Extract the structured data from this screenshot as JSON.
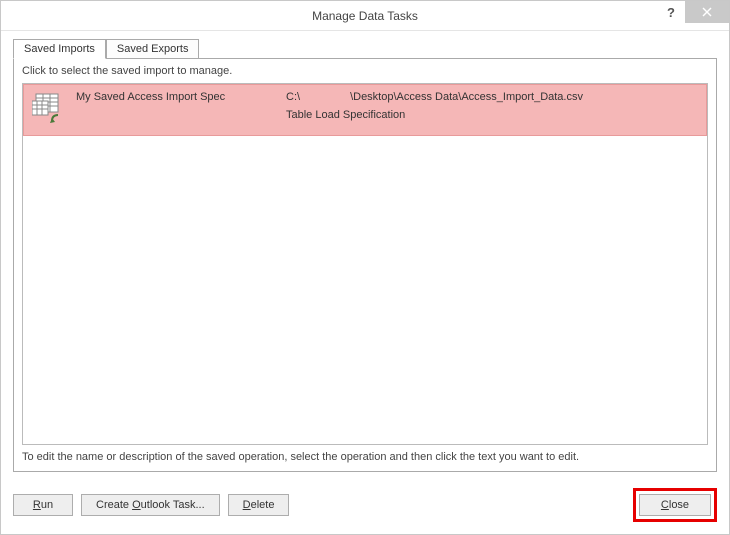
{
  "window": {
    "title": "Manage Data Tasks"
  },
  "tabs": {
    "saved_imports": "Saved Imports",
    "saved_exports": "Saved Exports"
  },
  "panel": {
    "instruction": "Click to select the saved import to manage.",
    "hint": "To edit the name or description of the saved operation, select the operation and then click the text you want to edit."
  },
  "import_item": {
    "name": "My Saved Access Import Spec",
    "path_prefix": "C:\\",
    "path_suffix": "\\Desktop\\Access Data\\Access_Import_Data.csv",
    "description": "Table Load Specification"
  },
  "buttons": {
    "run": "Run",
    "create_outlook_task": "Create Outlook Task...",
    "delete": "Delete",
    "close": "Close"
  }
}
